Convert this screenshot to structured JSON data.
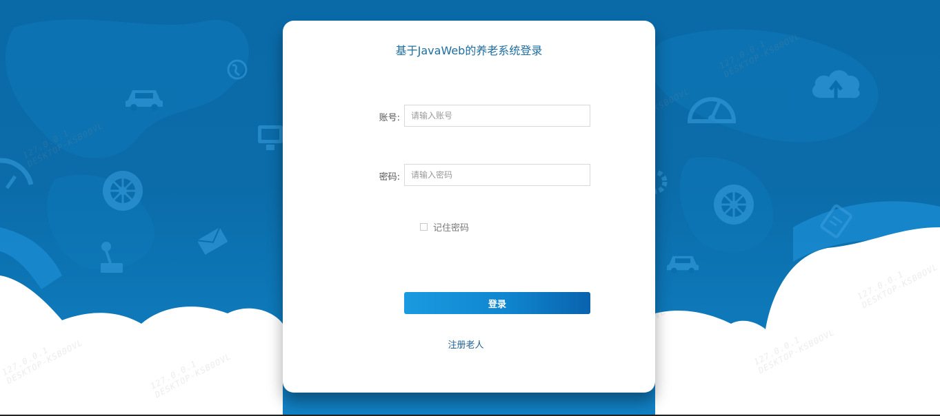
{
  "login": {
    "title": "基于JavaWeb的养老系统登录",
    "account_label": "账号:",
    "account_placeholder": "请输入账号",
    "account_value": "",
    "password_label": "密码:",
    "password_placeholder": "请输入密码",
    "password_value": "",
    "remember_label": "记住密码",
    "remember_checked": false,
    "login_button": "登录",
    "register_link": "注册老人"
  },
  "watermark": {
    "ip": "127.0.0.1",
    "host": "DESKTOP-KSB0OVL"
  },
  "background_icons": [
    "globe-icon",
    "car-icon",
    "computer-icon",
    "gauge-icon",
    "wheel-icon",
    "envelope-icon",
    "joystick-icon",
    "cloud-upload-icon",
    "gear-icon",
    "clipboard-icon",
    "speedometer-icon"
  ],
  "colors": {
    "background": "#0b6ca9",
    "accent": "#0f86cf",
    "title": "#1d6da0",
    "link": "#1d5e92"
  }
}
